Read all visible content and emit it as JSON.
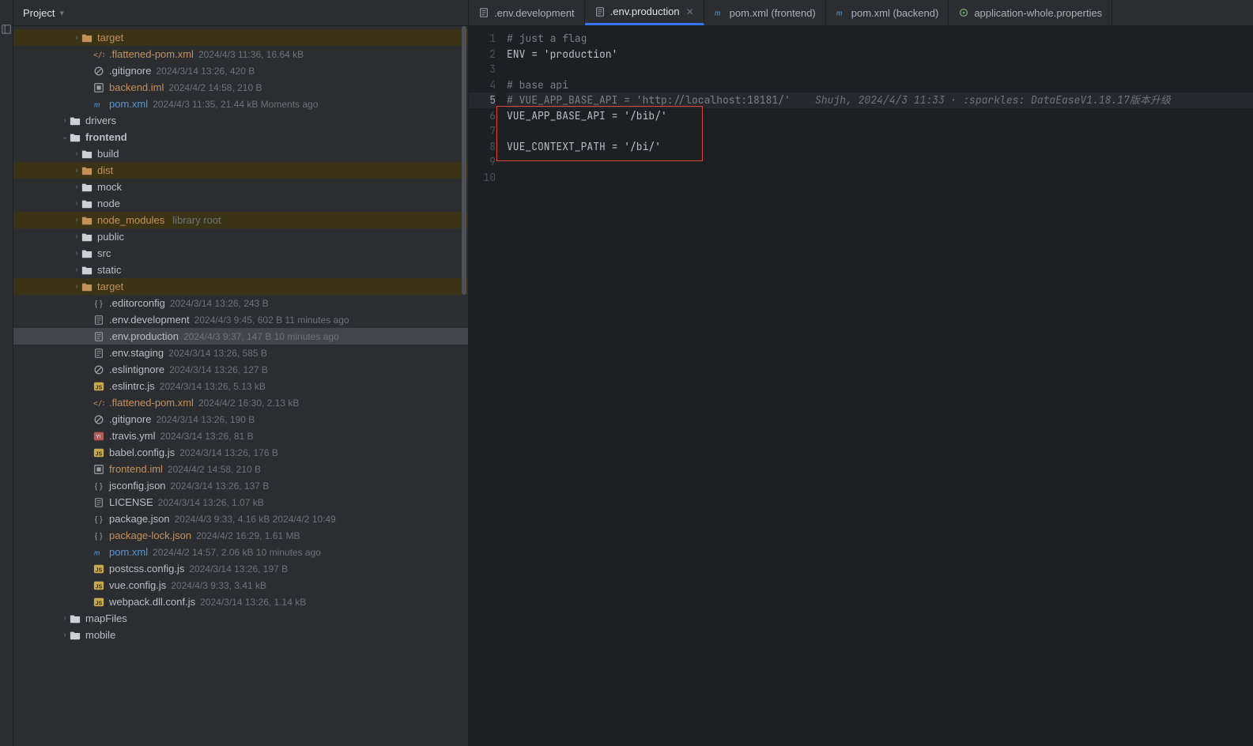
{
  "sidebar": {
    "title": "Project",
    "tree": [
      {
        "indent": 5,
        "arrow": ">",
        "iconType": "folder-o",
        "name": "target",
        "cls": "orange",
        "hl": true
      },
      {
        "indent": 6,
        "iconType": "xml",
        "name": ".flattened-pom.xml",
        "cls": "orange",
        "meta": "2024/4/3 11:36, 16.64 kB"
      },
      {
        "indent": 6,
        "iconType": "ignore",
        "name": ".gitignore",
        "meta": "2024/3/14 13:26, 420 B"
      },
      {
        "indent": 6,
        "iconType": "iml",
        "name": "backend.iml",
        "cls": "orange",
        "meta": "2024/4/2 14:58, 210 B"
      },
      {
        "indent": 6,
        "iconType": "maven",
        "name": "pom.xml",
        "cls": "blue",
        "meta": "2024/4/3 11:35, 21.44 kB Moments ago"
      },
      {
        "indent": 4,
        "arrow": ">",
        "iconType": "folder",
        "name": "drivers"
      },
      {
        "indent": 4,
        "arrow": "v",
        "iconType": "folder",
        "name": "frontend",
        "bold": true
      },
      {
        "indent": 5,
        "arrow": ">",
        "iconType": "folder",
        "name": "build"
      },
      {
        "indent": 5,
        "arrow": ">",
        "iconType": "folder-o",
        "name": "dist",
        "cls": "orange",
        "hl": true
      },
      {
        "indent": 5,
        "arrow": ">",
        "iconType": "folder",
        "name": "mock"
      },
      {
        "indent": 5,
        "arrow": ">",
        "iconType": "folder",
        "name": "node"
      },
      {
        "indent": 5,
        "arrow": ">",
        "iconType": "folder-o",
        "name": "node_modules",
        "cls": "orange",
        "libroot": "library root",
        "hl": true
      },
      {
        "indent": 5,
        "arrow": ">",
        "iconType": "folder",
        "name": "public"
      },
      {
        "indent": 5,
        "arrow": ">",
        "iconType": "folder",
        "name": "src"
      },
      {
        "indent": 5,
        "arrow": ">",
        "iconType": "folder",
        "name": "static"
      },
      {
        "indent": 5,
        "arrow": ">",
        "iconType": "folder-o",
        "name": "target",
        "cls": "orange",
        "hl": true
      },
      {
        "indent": 6,
        "iconType": "cfg",
        "name": ".editorconfig",
        "meta": "2024/3/14 13:26, 243 B"
      },
      {
        "indent": 6,
        "iconType": "txt",
        "name": ".env.development",
        "meta": "2024/4/3 9:45, 602 B 11 minutes ago"
      },
      {
        "indent": 6,
        "iconType": "txt",
        "name": ".env.production",
        "meta": "2024/4/3 9:37, 147 B 10 minutes ago",
        "sel": true
      },
      {
        "indent": 6,
        "iconType": "txt",
        "name": ".env.staging",
        "meta": "2024/3/14 13:26, 585 B"
      },
      {
        "indent": 6,
        "iconType": "ignore",
        "name": ".eslintignore",
        "meta": "2024/3/14 13:26, 127 B"
      },
      {
        "indent": 6,
        "iconType": "js",
        "name": ".eslintrc.js",
        "meta": "2024/3/14 13:26, 5.13 kB"
      },
      {
        "indent": 6,
        "iconType": "xml",
        "name": ".flattened-pom.xml",
        "cls": "orange",
        "meta": "2024/4/2 16:30, 2.13 kB"
      },
      {
        "indent": 6,
        "iconType": "ignore",
        "name": ".gitignore",
        "meta": "2024/3/14 13:26, 190 B"
      },
      {
        "indent": 6,
        "iconType": "yml",
        "name": ".travis.yml",
        "meta": "2024/3/14 13:26, 81 B"
      },
      {
        "indent": 6,
        "iconType": "js",
        "name": "babel.config.js",
        "meta": "2024/3/14 13:26, 176 B"
      },
      {
        "indent": 6,
        "iconType": "iml",
        "name": "frontend.iml",
        "cls": "orange",
        "meta": "2024/4/2 14:58, 210 B"
      },
      {
        "indent": 6,
        "iconType": "json",
        "name": "jsconfig.json",
        "meta": "2024/3/14 13:26, 137 B"
      },
      {
        "indent": 6,
        "iconType": "txt",
        "name": "LICENSE",
        "meta": "2024/3/14 13:26, 1.07 kB"
      },
      {
        "indent": 6,
        "iconType": "json",
        "name": "package.json",
        "meta": "2024/4/3 9:33, 4.16 kB 2024/4/2 10:49"
      },
      {
        "indent": 6,
        "iconType": "json",
        "name": "package-lock.json",
        "cls": "orange",
        "meta": "2024/4/2 16:29, 1.61 MB"
      },
      {
        "indent": 6,
        "iconType": "maven",
        "name": "pom.xml",
        "cls": "blue",
        "meta": "2024/4/2 14:57, 2.06 kB 10 minutes ago"
      },
      {
        "indent": 6,
        "iconType": "js",
        "name": "postcss.config.js",
        "meta": "2024/3/14 13:26, 197 B"
      },
      {
        "indent": 6,
        "iconType": "js",
        "name": "vue.config.js",
        "meta": "2024/4/3 9:33, 3.41 kB"
      },
      {
        "indent": 6,
        "iconType": "js",
        "name": "webpack.dll.conf.js",
        "meta": "2024/3/14 13:26, 1.14 kB"
      },
      {
        "indent": 4,
        "arrow": ">",
        "iconType": "folder",
        "name": "mapFiles"
      },
      {
        "indent": 4,
        "arrow": ">",
        "iconType": "folder",
        "name": "mobile"
      }
    ]
  },
  "tabs": [
    {
      "icon": "txt",
      "label": ".env.development"
    },
    {
      "icon": "txt",
      "label": ".env.production",
      "active": true,
      "close": true
    },
    {
      "icon": "maven",
      "label": "pom.xml (frontend)"
    },
    {
      "icon": "maven",
      "label": "pom.xml (backend)"
    },
    {
      "icon": "props",
      "label": "application-whole.properties"
    }
  ],
  "editor": {
    "lines": [
      {
        "n": 1,
        "t": "# just a flag",
        "c": "comment"
      },
      {
        "n": 2,
        "t": "ENV = 'production'"
      },
      {
        "n": 3,
        "t": ""
      },
      {
        "n": 4,
        "t": "# base api",
        "c": "comment"
      },
      {
        "n": 5,
        "t": "# VUE_APP_BASE_API = 'http://localhost:18181/'",
        "c": "comment",
        "annot": "    Shujh, 2024/4/3 11:33 · :sparkles: DataEaseV1.18.17版本升级",
        "hl": true
      },
      {
        "n": 6,
        "t": "VUE_APP_BASE_API = '/bib/'"
      },
      {
        "n": 7,
        "t": ""
      },
      {
        "n": 8,
        "t": "VUE_CONTEXT_PATH = '/bi/'"
      },
      {
        "n": 9,
        "t": ""
      },
      {
        "n": 10,
        "t": ""
      }
    ]
  }
}
